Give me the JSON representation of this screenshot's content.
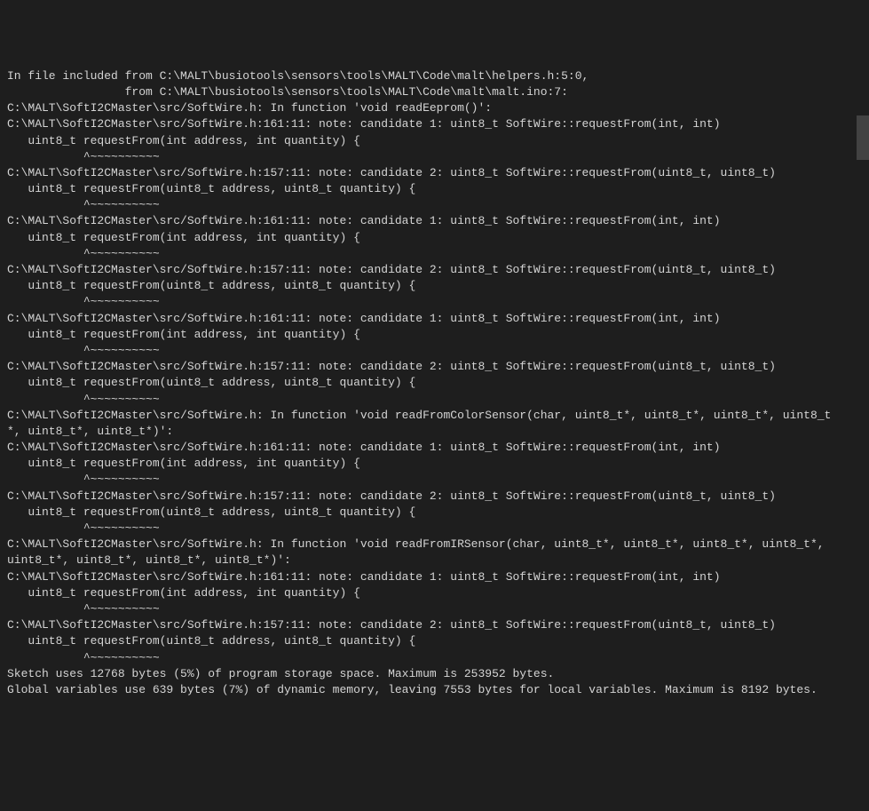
{
  "console": {
    "lines": [
      "In file included from C:\\MALT\\busiotools\\sensors\\tools\\MALT\\Code\\malt\\helpers.h:5:0,",
      "                 from C:\\MALT\\busiotools\\sensors\\tools\\MALT\\Code\\malt\\malt.ino:7:",
      "C:\\MALT\\SoftI2CMaster\\src/SoftWire.h: In function 'void readEeprom()':",
      "C:\\MALT\\SoftI2CMaster\\src/SoftWire.h:161:11: note: candidate 1: uint8_t SoftWire::requestFrom(int, int)",
      "   uint8_t requestFrom(int address, int quantity) {",
      "           ^~~~~~~~~~~",
      "C:\\MALT\\SoftI2CMaster\\src/SoftWire.h:157:11: note: candidate 2: uint8_t SoftWire::requestFrom(uint8_t, uint8_t)",
      "   uint8_t requestFrom(uint8_t address, uint8_t quantity) {",
      "           ^~~~~~~~~~~",
      "C:\\MALT\\SoftI2CMaster\\src/SoftWire.h:161:11: note: candidate 1: uint8_t SoftWire::requestFrom(int, int)",
      "   uint8_t requestFrom(int address, int quantity) {",
      "           ^~~~~~~~~~~",
      "C:\\MALT\\SoftI2CMaster\\src/SoftWire.h:157:11: note: candidate 2: uint8_t SoftWire::requestFrom(uint8_t, uint8_t)",
      "   uint8_t requestFrom(uint8_t address, uint8_t quantity) {",
      "           ^~~~~~~~~~~",
      "C:\\MALT\\SoftI2CMaster\\src/SoftWire.h:161:11: note: candidate 1: uint8_t SoftWire::requestFrom(int, int)",
      "   uint8_t requestFrom(int address, int quantity) {",
      "           ^~~~~~~~~~~",
      "C:\\MALT\\SoftI2CMaster\\src/SoftWire.h:157:11: note: candidate 2: uint8_t SoftWire::requestFrom(uint8_t, uint8_t)",
      "   uint8_t requestFrom(uint8_t address, uint8_t quantity) {",
      "           ^~~~~~~~~~~",
      "C:\\MALT\\SoftI2CMaster\\src/SoftWire.h: In function 'void readFromColorSensor(char, uint8_t*, uint8_t*, uint8_t*, uint8_t",
      "*, uint8_t*, uint8_t*)':",
      "C:\\MALT\\SoftI2CMaster\\src/SoftWire.h:161:11: note: candidate 1: uint8_t SoftWire::requestFrom(int, int)",
      "   uint8_t requestFrom(int address, int quantity) {",
      "           ^~~~~~~~~~~",
      "C:\\MALT\\SoftI2CMaster\\src/SoftWire.h:157:11: note: candidate 2: uint8_t SoftWire::requestFrom(uint8_t, uint8_t)",
      "   uint8_t requestFrom(uint8_t address, uint8_t quantity) {",
      "           ^~~~~~~~~~~",
      "C:\\MALT\\SoftI2CMaster\\src/SoftWire.h: In function 'void readFromIRSensor(char, uint8_t*, uint8_t*, uint8_t*, uint8_t*, ",
      "uint8_t*, uint8_t*, uint8_t*, uint8_t*)':",
      "C:\\MALT\\SoftI2CMaster\\src/SoftWire.h:161:11: note: candidate 1: uint8_t SoftWire::requestFrom(int, int)",
      "   uint8_t requestFrom(int address, int quantity) {",
      "           ^~~~~~~~~~~",
      "C:\\MALT\\SoftI2CMaster\\src/SoftWire.h:157:11: note: candidate 2: uint8_t SoftWire::requestFrom(uint8_t, uint8_t)",
      "   uint8_t requestFrom(uint8_t address, uint8_t quantity) {",
      "           ^~~~~~~~~~~",
      "Sketch uses 12768 bytes (5%) of program storage space. Maximum is 253952 bytes.",
      "Global variables use 639 bytes (7%) of dynamic memory, leaving 7553 bytes for local variables. Maximum is 8192 bytes."
    ]
  }
}
